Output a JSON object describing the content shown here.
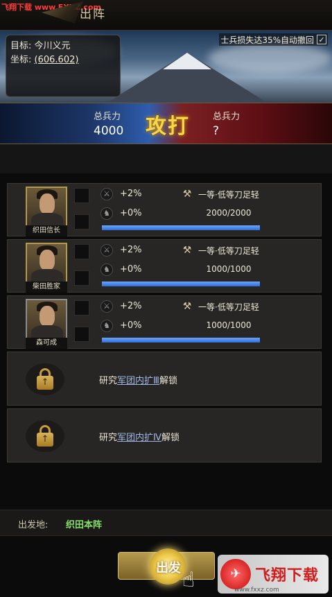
{
  "watermark_top": "飞翔下载 www.FXXZ.com",
  "header": {
    "title": "出阵"
  },
  "target": {
    "label_target": "目标:",
    "target_name": "今川义元",
    "label_coord": "坐标:",
    "coord": "(606.602)"
  },
  "auto_retreat": {
    "label": "士兵损失达35%自动撤回",
    "checked": true,
    "check_glyph": "✓"
  },
  "battle": {
    "left_label": "总兵力",
    "left_value": "4000",
    "attack_label": "攻打",
    "right_label": "总兵力",
    "right_value": "?"
  },
  "generals": [
    {
      "name": "织田信长",
      "stat1": "+2%",
      "stat2": "+0%",
      "troop": "一等·低等刀足轻",
      "count": "2000/2000",
      "fill": 1.0,
      "frame": "gold"
    },
    {
      "name": "柴田胜家",
      "stat1": "+2%",
      "stat2": "+0%",
      "troop": "一等·低等刀足轻",
      "count": "1000/1000",
      "fill": 1.0,
      "frame": "gold"
    },
    {
      "name": "森可成",
      "stat1": "+2%",
      "stat2": "+0%",
      "troop": "一等·低等刀足轻",
      "count": "1000/1000",
      "fill": 1.0,
      "frame": "gray"
    }
  ],
  "locked_slots": [
    {
      "prefix": "研究",
      "link": "军团内扩Ⅲ",
      "suffix": "解锁"
    },
    {
      "prefix": "研究",
      "link": "军团内扩Ⅳ",
      "suffix": "解锁"
    }
  ],
  "origin": {
    "label": "出发地:",
    "value": "织田本阵"
  },
  "depart_button": {
    "label": "出发"
  },
  "logo": {
    "mark": "✈",
    "text": "飞翔下载",
    "url": "www.fxxz.com"
  },
  "icons": {
    "attack_stat": "sword-icon",
    "defense_stat": "horse-icon",
    "troop_type": "spear-icon",
    "lock": "padlock-icon"
  }
}
